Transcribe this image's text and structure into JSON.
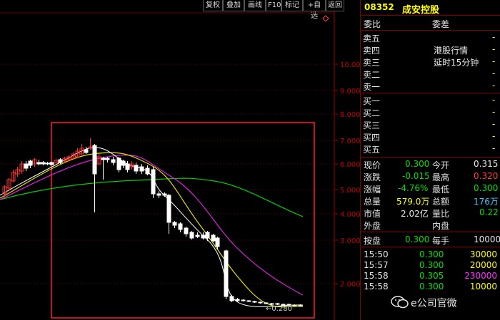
{
  "toolbar": {
    "buttons": [
      "复权",
      "叠加",
      "画线",
      "F10",
      "标记",
      "+自选",
      "返回"
    ]
  },
  "stock": {
    "code": "08352",
    "name": "成安控股"
  },
  "order_book": {
    "ratio_label": "委比",
    "diff_label": "委差",
    "sell": [
      "卖五",
      "卖四",
      "卖三",
      "卖二",
      "卖一"
    ],
    "buy": [
      "买一",
      "买二",
      "买三",
      "买四",
      "买五"
    ],
    "delay_note_1": "港股行情",
    "delay_note_2": "延时15分钟",
    "dash": "-"
  },
  "quote": {
    "current_label": "现价",
    "current": "0.300",
    "open_label": "今开",
    "open": "0.315",
    "change_label": "涨跌",
    "change": "-0.015",
    "high_label": "最高",
    "high": "0.320",
    "pct_label": "涨幅",
    "pct": "-4.76%",
    "low_label": "最低",
    "low": "0.300",
    "volume_label": "总量",
    "volume": "579.0万",
    "amount_label": "总额",
    "amount": "176万",
    "mktcap_label": "市值",
    "mktcap": "2.02亿",
    "volratio_label": "量比",
    "volratio": "0.22",
    "outer_label": "外盘",
    "inner_label": "内盘",
    "bid_label": "按盘",
    "bid": "0.300",
    "lot_label": "每手",
    "lot": "10000"
  },
  "trades": [
    {
      "time": "15:50",
      "price": "0.300",
      "vol": "30000",
      "color": "#ffff00"
    },
    {
      "time": "15:57",
      "price": "0.300",
      "vol": "20000",
      "color": "#ffff00"
    },
    {
      "time": "15:58",
      "price": "0.305",
      "vol": "230000",
      "color": "#ff30ff"
    },
    {
      "time": "15:58",
      "price": "0.300",
      "vol": "10000",
      "color": "#ffff00"
    }
  ],
  "watermark": "e公司官微",
  "chart_data": {
    "type": "candlestick",
    "y_axis_ticks": [
      "10.00",
      "9.000",
      "8.000",
      "7.000",
      "6.000",
      "5.000",
      "4.000",
      "3.000",
      "2.000"
    ],
    "last_price_marker": "←0.280",
    "note": "price axis on log scale; highlighted region outlined in red"
  }
}
